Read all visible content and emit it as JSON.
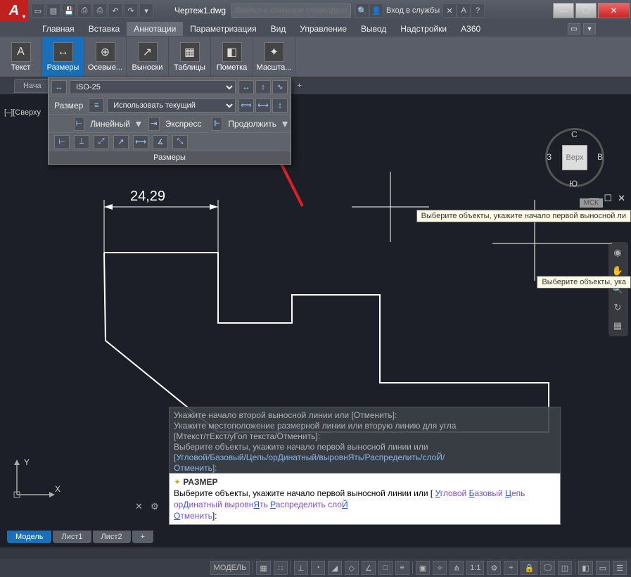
{
  "titlebar": {
    "doc": "Чертеж1.dwg",
    "search_placeholder": "Введите ключевое слово/фразу",
    "signin": "Вход в службы"
  },
  "menu": {
    "items": [
      "Главная",
      "Вставка",
      "Аннотации",
      "Параметризация",
      "Вид",
      "Управление",
      "Вывод",
      "Надстройки",
      "A360"
    ],
    "active_index": 2
  },
  "ribbon": {
    "items": [
      {
        "label": "Текст",
        "icon": "А"
      },
      {
        "label": "Размеры",
        "icon": "⟷"
      },
      {
        "label": "Осевые...",
        "icon": "⊕"
      },
      {
        "label": "Выноски",
        "icon": "⤴"
      },
      {
        "label": "Таблицы",
        "icon": "▦"
      },
      {
        "label": "Пометка",
        "icon": "◧"
      },
      {
        "label": "Масшта...",
        "icon": "✦"
      }
    ],
    "active_index": 1
  },
  "tabstrip": {
    "label": "Нача"
  },
  "view_label": "[–][Сверху",
  "dropdown": {
    "row1_label": "Размер",
    "style": "ISO-25",
    "layer": "Использовать текущий",
    "linear": "Линейный",
    "express": "Экспресс",
    "continue": "Продолжить",
    "panel_title": "Размеры"
  },
  "dimension": {
    "value": "24,29"
  },
  "viewcube": {
    "face": "Верх",
    "n": "С",
    "s": "Ю",
    "e": "В",
    "w": "З",
    "mck": "МСК"
  },
  "tooltip_full": "Выберите объекты, укажите начало первой выносной ли",
  "tooltip_cut": "Выберите объекты, ука",
  "cmdlog": {
    "l1": "Укажите начало второй выносной линии или [Отменить]:",
    "l2": "Укажите местоположение размерной линии или вторую линию для угла",
    "l3": "[Мтекст/тЕкст/уГол текста/Отменить]:",
    "l4": "Выберите объекты, укажите начало первой выносной линии или",
    "l5": "[Угловой/Базовый/Цепь/орДинатный/выровнЯть/Распределить/слоЙ/",
    "l6": "Отменить]:"
  },
  "cmdline": {
    "cmd": "РАЗМЕР",
    "prompt": "Выберите объекты, укажите начало первой выносной линии или [",
    "opts": [
      {
        "u": "У",
        "rest": "гловой"
      },
      {
        "u": "Б",
        "rest": "азовый"
      },
      {
        "u": "Ц",
        "rest": "епь"
      },
      {
        "u": "Д",
        "rest": "инатный",
        "pre": "ор"
      },
      {
        "u": "Я",
        "rest": "ть",
        "pre": "выровн"
      },
      {
        "u": "Р",
        "rest": "аспределить"
      },
      {
        "u": "Й",
        "rest": "",
        "pre": "сло"
      }
    ],
    "end": "Отменить]:"
  },
  "bottom_tabs": [
    "Модель",
    "Лист1",
    "Лист2"
  ],
  "statusbar": {
    "model": "МОДЕЛЬ",
    "scale": "1:1"
  }
}
